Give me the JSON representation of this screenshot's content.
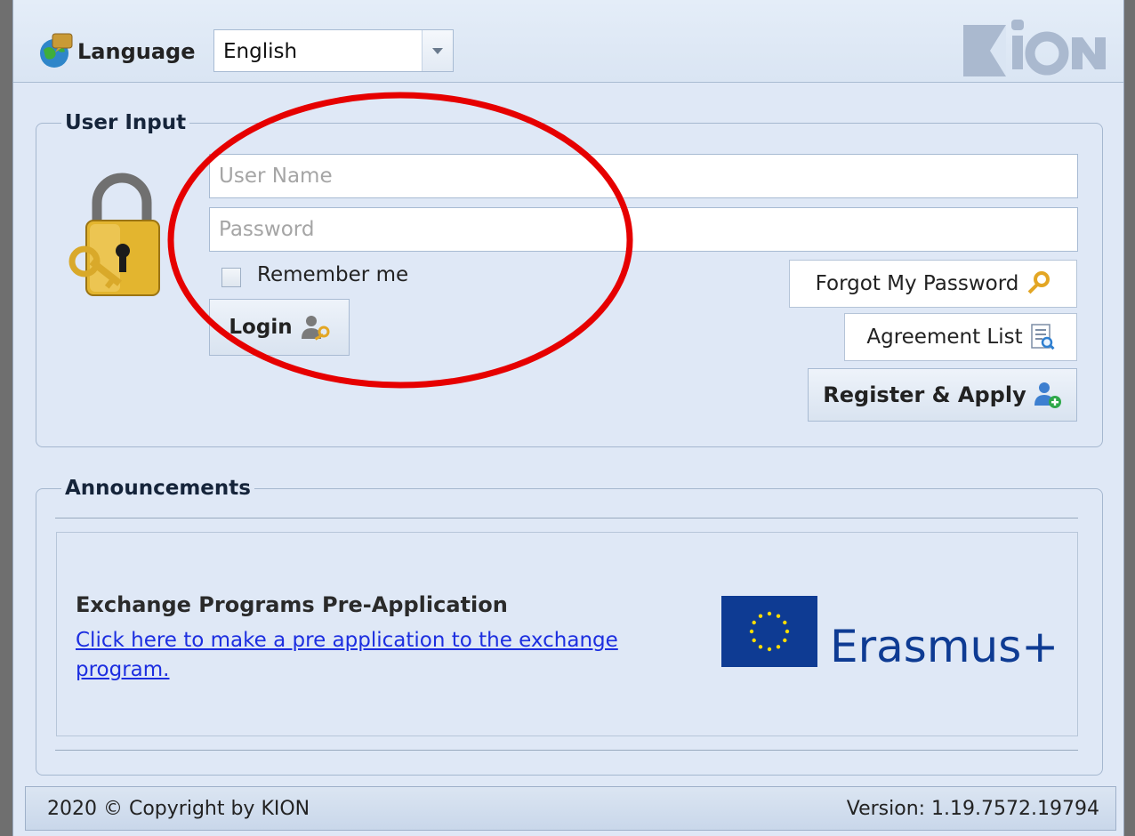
{
  "header": {
    "language_label": "Language",
    "language_selected": "English",
    "logo_text": "KION"
  },
  "login": {
    "group_title": "User Input",
    "username_placeholder": "User Name",
    "password_placeholder": "Password",
    "remember_label": "Remember me",
    "remember_checked": false,
    "login_label": "Login",
    "forgot_label": "Forgot My Password",
    "agreement_label": "Agreement List",
    "register_label": "Register & Apply"
  },
  "announcements": {
    "group_title": "Announcements",
    "item_title": "Exchange Programs Pre-Application",
    "item_link": "Click here to make a pre application to the exchange program.",
    "logo_text": "Erasmus+"
  },
  "footer": {
    "copyright": "2020 © Copyright by KION",
    "version": "Version: 1.19.7572.19794"
  },
  "colors": {
    "panel_background": "#dfe8f6",
    "link": "#1c2ee0",
    "annotation": "#e60000",
    "eu_blue": "#0e3b93",
    "eu_star": "#ffdd00"
  }
}
